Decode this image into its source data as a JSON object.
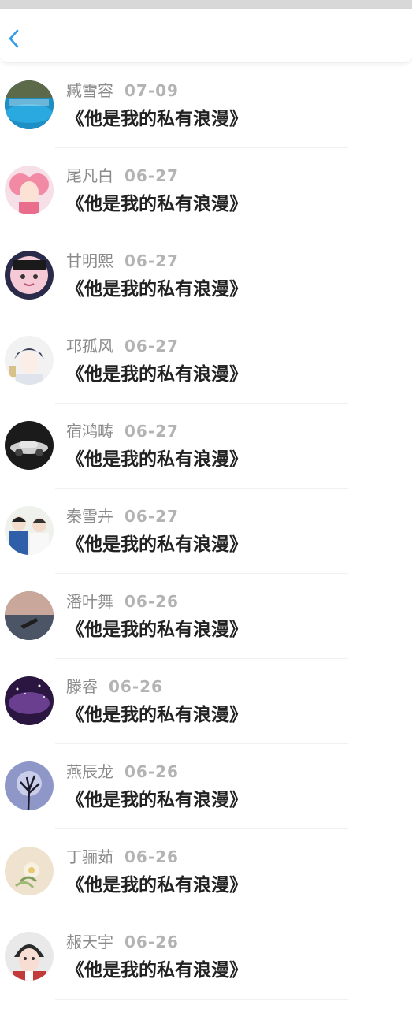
{
  "header": {
    "back_icon": "chevron-left-icon",
    "accent_color": "#2f9bec"
  },
  "items": [
    {
      "name": "臧雪容",
      "date": "07-09",
      "title": "《他是我的私有浪漫》",
      "avatar": "ocean-scene-avatar"
    },
    {
      "name": "尾凡白",
      "date": "06-27",
      "title": "《他是我的私有浪漫》",
      "avatar": "anime-girl-avatar"
    },
    {
      "name": "甘明熙",
      "date": "06-27",
      "title": "《他是我的私有浪漫》",
      "avatar": "cartoon-face-avatar"
    },
    {
      "name": "邛孤风",
      "date": "06-27",
      "title": "《他是我的私有浪漫》",
      "avatar": "anime-boy-avatar"
    },
    {
      "name": "宿鸿畴",
      "date": "06-27",
      "title": "《他是我的私有浪漫》",
      "avatar": "vintage-car-avatar"
    },
    {
      "name": "秦雪卉",
      "date": "06-27",
      "title": "《他是我的私有浪漫》",
      "avatar": "two-boys-avatar"
    },
    {
      "name": "潘叶舞",
      "date": "06-26",
      "title": "《他是我的私有浪漫》",
      "avatar": "sky-scene-avatar"
    },
    {
      "name": "滕睿",
      "date": "06-26",
      "title": "《他是我的私有浪漫》",
      "avatar": "purple-galaxy-avatar"
    },
    {
      "name": "燕辰龙",
      "date": "06-26",
      "title": "《他是我的私有浪漫》",
      "avatar": "tree-moon-avatar"
    },
    {
      "name": "丁骊茹",
      "date": "06-26",
      "title": "《他是我的私有浪漫》",
      "avatar": "flower-avatar"
    },
    {
      "name": "赧天宇",
      "date": "06-26",
      "title": "《他是我的私有浪漫》",
      "avatar": "child-portrait-avatar"
    }
  ]
}
